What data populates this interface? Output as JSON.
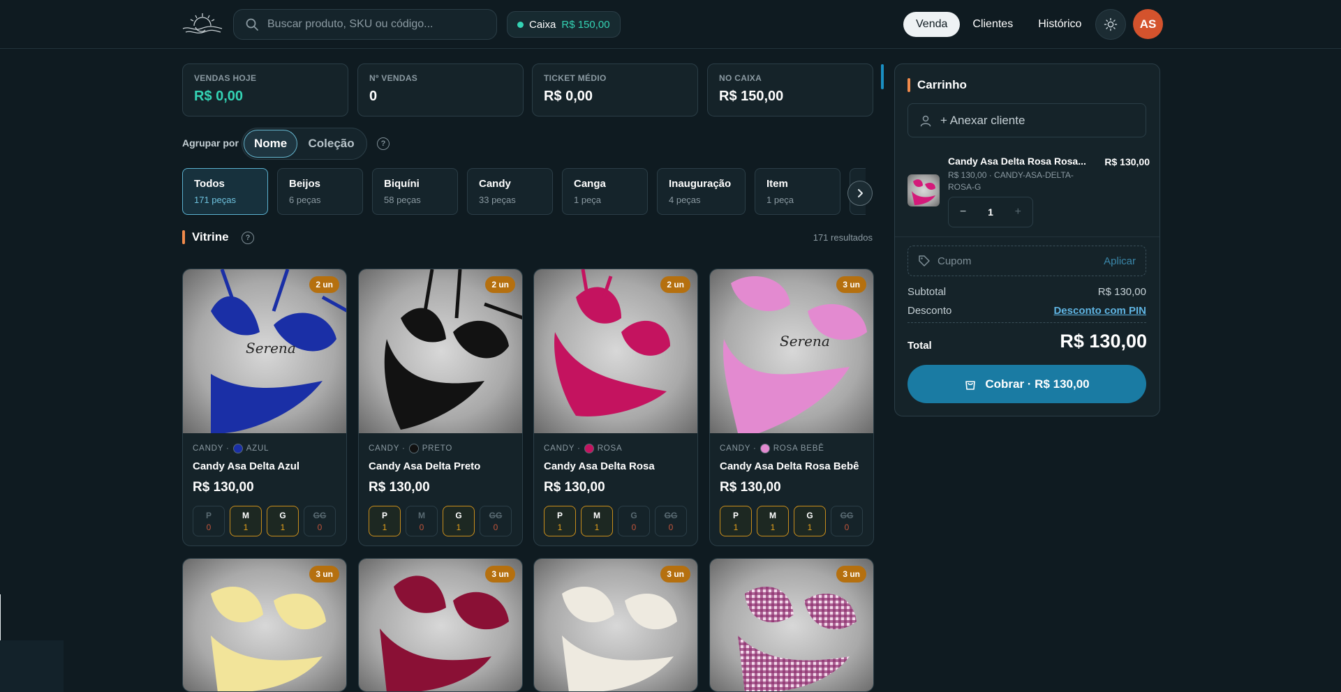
{
  "header": {
    "search_placeholder": "Buscar produto, SKU ou código...",
    "caixa_label": "Caixa",
    "caixa_value": "R$ 150,00",
    "nav": [
      "Venda",
      "Clientes",
      "Histórico"
    ],
    "avatar": "AS"
  },
  "stats": [
    {
      "title": "VENDAS HOJE",
      "value": "R$ 0,00"
    },
    {
      "title": "Nº VENDAS",
      "value": "0"
    },
    {
      "title": "TICKET MÉDIO",
      "value": "R$ 0,00"
    },
    {
      "title": "NO CAIXA",
      "value": "R$ 150,00"
    }
  ],
  "group": {
    "label": "Agrupar por",
    "options": [
      "Nome",
      "Coleção"
    ],
    "help": "?"
  },
  "categories": [
    {
      "name": "Todos",
      "count": "171 peças"
    },
    {
      "name": "Beijos",
      "count": "6 peças"
    },
    {
      "name": "Biquíni",
      "count": "58 peças"
    },
    {
      "name": "Candy",
      "count": "33 peças"
    },
    {
      "name": "Canga",
      "count": "1 peça"
    },
    {
      "name": "Inauguração",
      "count": "4 peças"
    },
    {
      "name": "Item",
      "count": "1 peça"
    }
  ],
  "vitrine": {
    "title": "Vitrine",
    "results": "171 resultados"
  },
  "products": [
    {
      "badge": "2 un",
      "collection": "CANDY ·",
      "color": "AZUL",
      "color_hex": "#1a2fa6",
      "name": "Candy Asa Delta Azul",
      "price": "R$ 130,00",
      "sizes": [
        {
          "s": "P",
          "q": "0"
        },
        {
          "s": "M",
          "q": "1"
        },
        {
          "s": "G",
          "q": "1"
        },
        {
          "s": "GG",
          "q": "0"
        }
      ]
    },
    {
      "badge": "2 un",
      "collection": "CANDY ·",
      "color": "PRETO",
      "color_hex": "#111111",
      "name": "Candy Asa Delta Preto",
      "price": "R$ 130,00",
      "sizes": [
        {
          "s": "P",
          "q": "1"
        },
        {
          "s": "M",
          "q": "0"
        },
        {
          "s": "G",
          "q": "1"
        },
        {
          "s": "GG",
          "q": "0"
        }
      ]
    },
    {
      "badge": "2 un",
      "collection": "CANDY ·",
      "color": "ROSA",
      "color_hex": "#c4135f",
      "name": "Candy Asa Delta Rosa",
      "price": "R$ 130,00",
      "sizes": [
        {
          "s": "P",
          "q": "1"
        },
        {
          "s": "M",
          "q": "1"
        },
        {
          "s": "G",
          "q": "0"
        },
        {
          "s": "GG",
          "q": "0"
        }
      ]
    },
    {
      "badge": "3 un",
      "collection": "CANDY ·",
      "color": "ROSA BEBÊ",
      "color_hex": "#e38ad0",
      "name": "Candy Asa Delta Rosa Bebê",
      "price": "R$ 130,00",
      "sizes": [
        {
          "s": "P",
          "q": "1"
        },
        {
          "s": "M",
          "q": "1"
        },
        {
          "s": "G",
          "q": "1"
        },
        {
          "s": "GG",
          "q": "0"
        }
      ]
    },
    {
      "badge": "3 un"
    },
    {
      "badge": "3 un"
    },
    {
      "badge": "3 un"
    },
    {
      "badge": "3 un"
    }
  ],
  "cart": {
    "title": "Carrinho",
    "attach": "+ Anexar cliente",
    "item": {
      "name": "Candy Asa Delta Rosa Rosa...",
      "price": "R$ 130,00",
      "sub": "R$ 130,00 · CANDY-ASA-DELTA-ROSA-G",
      "qty": "1"
    },
    "coupon_placeholder": "Cupom",
    "coupon_apply": "Aplicar",
    "subtotal_label": "Subtotal",
    "subtotal_value": "R$ 130,00",
    "discount_label": "Desconto",
    "discount_link": "Desconto com PIN",
    "total_label": "Total",
    "total_value": "R$ 130,00",
    "pay_label": "Cobrar ·  R$ 130,00"
  },
  "colors": {
    "background": "#0f1b21",
    "teal": "#34d3b4",
    "badge": "#b5700f",
    "accent_orange": "#f08a4b",
    "pay_button": "#1a7ba3",
    "avatar": "#d4532d"
  }
}
